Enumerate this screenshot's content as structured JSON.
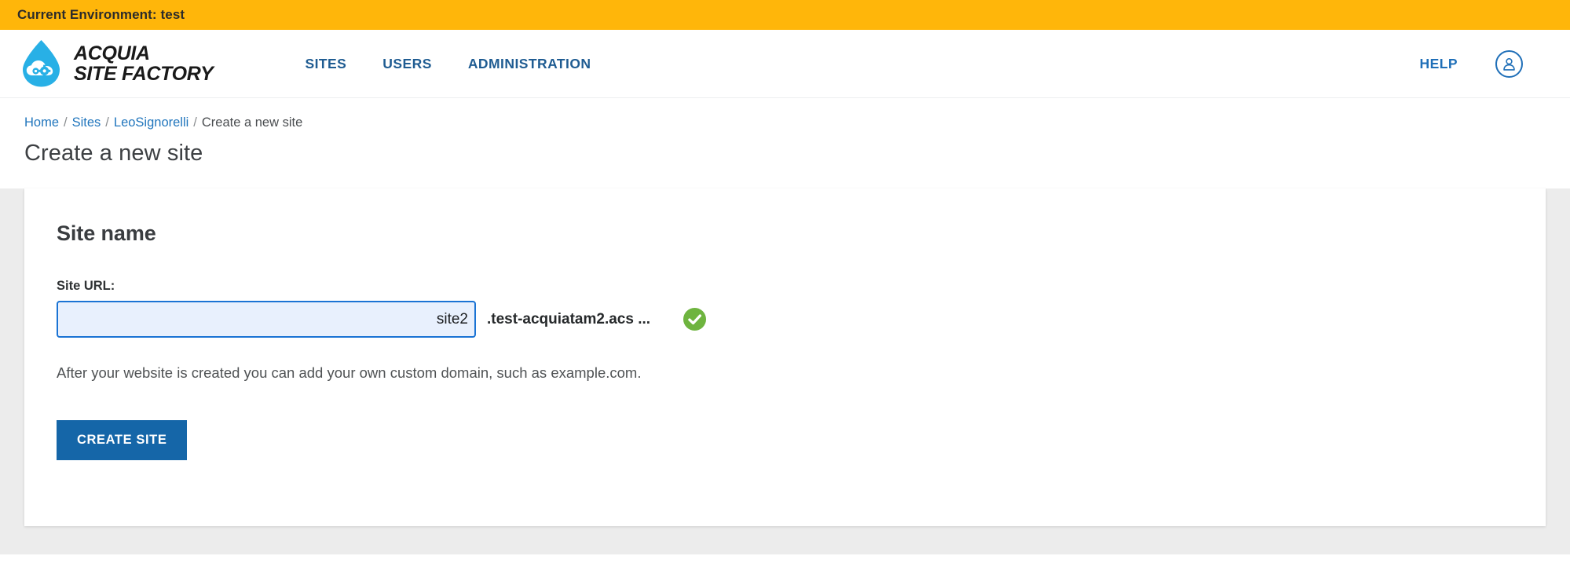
{
  "env_banner": {
    "text": "Current Environment: test",
    "background": "#ffb60a"
  },
  "masthead": {
    "brand": {
      "line1": "ACQUIA",
      "line2": "SITE FACTORY",
      "logo_icon": "acquia-droplet-icon"
    },
    "nav": [
      {
        "label": "SITES",
        "name": "nav-link-sites"
      },
      {
        "label": "USERS",
        "name": "nav-link-users"
      },
      {
        "label": "ADMINISTRATION",
        "name": "nav-link-administration"
      }
    ],
    "help_label": "HELP",
    "account_icon": "user-avatar-icon",
    "link_color": "#1f5c92"
  },
  "page_head": {
    "breadcrumb": [
      {
        "label": "Home",
        "link": true
      },
      {
        "label": "Sites",
        "link": true
      },
      {
        "label": "LeoSignorelli",
        "link": true
      },
      {
        "label": "Create a new site",
        "link": false
      }
    ],
    "separator": "/",
    "title": "Create a new site"
  },
  "card": {
    "title": "Site name",
    "field": {
      "label": "Site URL:",
      "value": "site2",
      "placeholder": "",
      "domain_suffix": ".test-acquiatam2.acs ...",
      "status_icon": "green-check-circle-icon",
      "status_color": "#6eb43f",
      "focused": true
    },
    "help_text": "After your website is created you can add your own custom domain, such as example.com.",
    "submit_label": "CREATE SITE",
    "submit_color": "#1566a8"
  }
}
